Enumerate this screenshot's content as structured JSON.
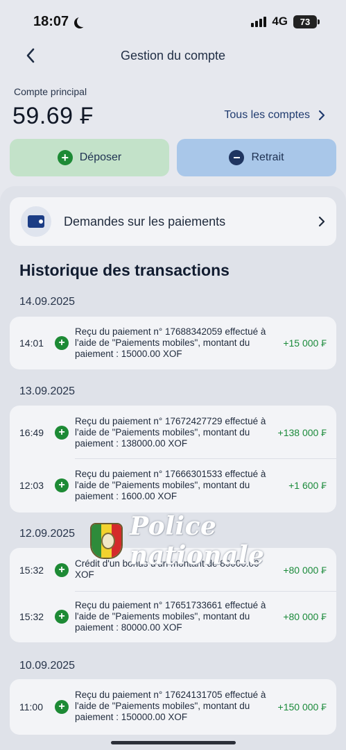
{
  "status_bar": {
    "time": "18:07",
    "network": "4G",
    "battery": "73"
  },
  "nav": {
    "title": "Gestion du compte"
  },
  "account": {
    "label": "Compte principal",
    "balance": "59.69 ₣",
    "all_accounts": "Tous les comptes"
  },
  "actions": {
    "deposit": "Déposer",
    "withdraw": "Retrait"
  },
  "payment_requests": {
    "label": "Demandes sur les paiements"
  },
  "history": {
    "title": "Historique des transactions",
    "groups": [
      {
        "date": "14.09.2025",
        "transactions": [
          {
            "time": "14:01",
            "description": "Reçu du paiement n° 17688342059 effectué à l'aide de \"Paiements mobiles\", montant du paiement : 15000.00 XOF",
            "amount": "+15 000 ₣"
          }
        ]
      },
      {
        "date": "13.09.2025",
        "transactions": [
          {
            "time": "16:49",
            "description": "Reçu du paiement n° 17672427729 effectué à l'aide de \"Paiements mobiles\", montant du paiement : 138000.00 XOF",
            "amount": "+138 000 ₣"
          },
          {
            "time": "12:03",
            "description": "Reçu du paiement n° 17666301533 effectué à l'aide de \"Paiements mobiles\", montant du paiement : 1600.00 XOF",
            "amount": "+1 600 ₣"
          }
        ]
      },
      {
        "date": "12.09.2025",
        "transactions": [
          {
            "time": "15:32",
            "description": "Crédit d'un bonus d'un montant de 80000.00 XOF",
            "amount": "+80 000 ₣"
          },
          {
            "time": "15:32",
            "description": "Reçu du paiement n° 17651733661 effectué à l'aide de \"Paiements mobiles\", montant du paiement : 80000.00 XOF",
            "amount": "+80 000 ₣"
          }
        ]
      },
      {
        "date": "10.09.2025",
        "transactions": [
          {
            "time": "11:00",
            "description": "Reçu du paiement n° 17624131705 effectué à l'aide de \"Paiements mobiles\", montant du paiement : 150000.00 XOF",
            "amount": "+150 000 ₣"
          }
        ]
      }
    ]
  },
  "watermark": {
    "text": "Police nationale"
  },
  "colors": {
    "accent_green": "#1d8a35",
    "accent_navy": "#1f3560",
    "amount_green": "#1a8a3a"
  },
  "icons": [
    "moon-icon",
    "signal-icon",
    "battery-icon",
    "back-chevron-icon",
    "chevron-right-icon",
    "plus-circle-icon",
    "minus-circle-icon",
    "wallet-icon"
  ]
}
